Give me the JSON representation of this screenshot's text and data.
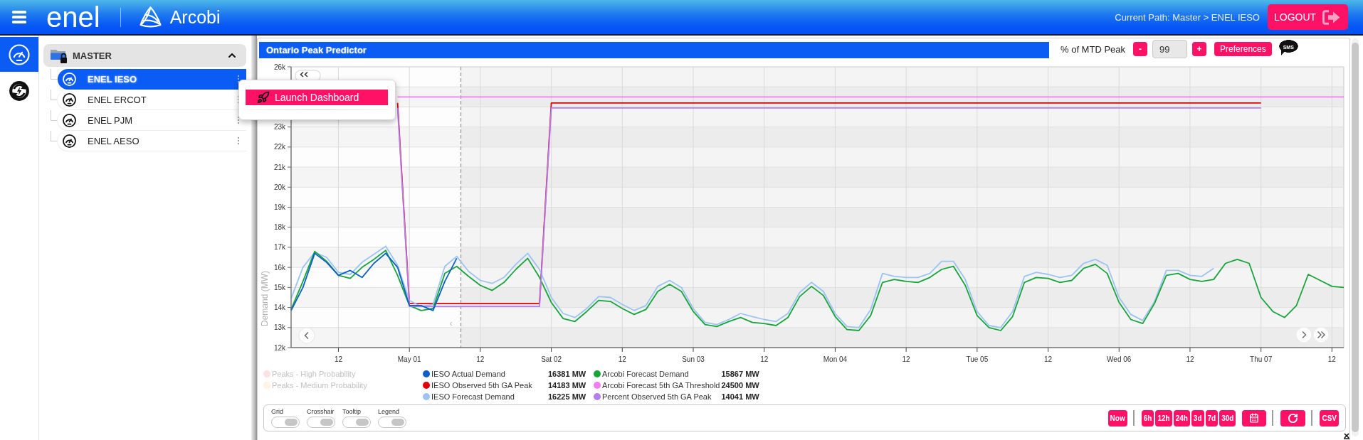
{
  "top_bar": {
    "brand": "enel",
    "app_name": "Arcobi",
    "current_path": "Current Path: Master > ENEL IESO",
    "logout": "LOGOUT"
  },
  "rail": [
    {
      "kind": "gauge",
      "selected": true
    },
    {
      "kind": "lightning",
      "selected": false
    }
  ],
  "tree": {
    "label": "MASTER",
    "expanded": true,
    "children": [
      {
        "label": "ENEL IESO",
        "selected": true
      },
      {
        "label": "ENEL ERCOT",
        "selected": false
      },
      {
        "label": "ENEL PJM",
        "selected": false
      },
      {
        "label": "ENEL AESO",
        "selected": false
      }
    ]
  },
  "context_menu": {
    "items": [
      "Launch Dashboard"
    ]
  },
  "panel": {
    "title": "Ontario Peak Predictor",
    "mtd_label": "% of MTD Peak",
    "decrement": "-",
    "value": "99",
    "increment": "+",
    "preferences": "Preferences",
    "sms": "SMS"
  },
  "chart": {
    "chart_data": {
      "type": "line",
      "ylabel": "Demand (MW)",
      "grid": true,
      "ylim": [
        12000,
        26000
      ],
      "categories": [
        null,
        null,
        null,
        null,
        "12",
        null,
        null,
        null,
        null,
        null,
        "May 01",
        null,
        null,
        null,
        null,
        null,
        "12",
        null,
        null,
        null,
        null,
        null,
        "Sat 02",
        null,
        null,
        null,
        null,
        null,
        "12",
        null,
        null,
        null,
        null,
        null,
        "Sun 03",
        null,
        null,
        null,
        null,
        null,
        "12",
        null,
        null,
        null,
        null,
        null,
        "Mon 04",
        null,
        null,
        null,
        null,
        null,
        "12",
        null,
        null,
        null,
        null,
        null,
        "Tue 05",
        null,
        null,
        null,
        null,
        null,
        "12",
        null,
        null,
        null,
        null,
        null,
        "Wed 06",
        null,
        null,
        null,
        null,
        null,
        "12",
        null,
        null,
        null,
        null,
        null,
        "Thu 07",
        null,
        null,
        null,
        null,
        null,
        "12",
        null
      ],
      "yticks": [
        {
          "value": 12000,
          "label": "12k"
        },
        {
          "value": 13000,
          "label": "13k"
        },
        {
          "value": 14000,
          "label": "14k"
        },
        {
          "value": 15000,
          "label": "15k"
        },
        {
          "value": 16000,
          "label": "16k"
        },
        {
          "value": 17000,
          "label": "17k"
        },
        {
          "value": 18000,
          "label": "18k"
        },
        {
          "value": 19000,
          "label": "19k"
        },
        {
          "value": 20000,
          "label": "20k"
        },
        {
          "value": 21000,
          "label": "21k"
        },
        {
          "value": 22000,
          "label": "22k"
        },
        {
          "value": 23000,
          "label": "23k"
        },
        {
          "value": 26000,
          "label": "26k"
        }
      ],
      "series": [
        {
          "name": "IESO Actual Demand",
          "color": "#0b5fc6",
          "values": [
            13850,
            15000,
            16700,
            16250,
            15600,
            15850,
            15500,
            16200,
            16700,
            16000,
            14100,
            14100,
            13850,
            15300,
            16450,
            null,
            null,
            null,
            null,
            null,
            null,
            null,
            null,
            null,
            null,
            null,
            null,
            null,
            null,
            null,
            null,
            null,
            null,
            null,
            null,
            null,
            null,
            null,
            null,
            null,
            null,
            null,
            null,
            null,
            null,
            null,
            null,
            null,
            null,
            null,
            null,
            null,
            null,
            null,
            null,
            null,
            null,
            null,
            null,
            null,
            null,
            null,
            null,
            null,
            null,
            null,
            null,
            null,
            null,
            null,
            null,
            null,
            null,
            null,
            null,
            null,
            null,
            null,
            null,
            null,
            null,
            null,
            null,
            null,
            null,
            null,
            null,
            null,
            null,
            null
          ]
        },
        {
          "name": "IESO Observed 5th GA Peak",
          "color": "#e00000",
          "values": [
            null,
            null,
            null,
            null,
            null,
            null,
            null,
            null,
            null,
            24200,
            14200,
            14200,
            14200,
            14200,
            14200,
            14200,
            14200,
            14200,
            14200,
            14200,
            14200,
            14200,
            24200,
            24200,
            24200,
            24200,
            24200,
            24200,
            24200,
            24200,
            24200,
            24200,
            24200,
            24200,
            24200,
            24200,
            24200,
            24200,
            24200,
            24200,
            24200,
            24200,
            24200,
            24200,
            24200,
            24200,
            24200,
            24200,
            24200,
            24200,
            24200,
            24200,
            24200,
            24200,
            24200,
            24200,
            24200,
            24200,
            24200,
            24200,
            24200,
            24200,
            24200,
            24200,
            24200,
            24200,
            24200,
            24200,
            24200,
            24200,
            24200,
            24200,
            24200,
            24200,
            24200,
            24200,
            24200,
            24200,
            24200,
            24200,
            24200,
            24200,
            24200,
            null,
            null,
            null,
            null,
            null,
            null,
            null
          ]
        },
        {
          "name": "IESO Forecast Demand",
          "color": "#9cc4f2",
          "values": [
            14450,
            16000,
            16750,
            16500,
            15750,
            15650,
            16250,
            16650,
            17050,
            16100,
            14350,
            14050,
            14150,
            16050,
            16550,
            15800,
            15350,
            15200,
            15500,
            16150,
            16700,
            15900,
            14500,
            13700,
            13500,
            13950,
            14550,
            14500,
            14150,
            13850,
            14100,
            15050,
            15350,
            15000,
            13950,
            13250,
            13150,
            13400,
            13700,
            13550,
            13400,
            13300,
            13700,
            14750,
            15250,
            14800,
            13700,
            13050,
            13000,
            13900,
            15700,
            15550,
            15500,
            15500,
            15700,
            16300,
            16300,
            15400,
            13800,
            13100,
            13000,
            13800,
            15550,
            15750,
            15650,
            15500,
            15600,
            16200,
            16400,
            16100,
            14500,
            13650,
            13350,
            14300,
            15850,
            15850,
            15600,
            15550,
            15950,
            null,
            null,
            null,
            null,
            null,
            null,
            null,
            null,
            null,
            null,
            null
          ]
        },
        {
          "name": "Arcobi Forecast Demand",
          "color": "#17a53a",
          "values": [
            13900,
            15300,
            16800,
            16300,
            15600,
            15450,
            16000,
            16400,
            16850,
            15600,
            14100,
            13850,
            13950,
            15700,
            16050,
            15550,
            15100,
            14850,
            15250,
            15900,
            16450,
            15500,
            14250,
            13450,
            13300,
            13800,
            14350,
            14300,
            13950,
            13650,
            13900,
            14800,
            15150,
            14800,
            13800,
            13150,
            13050,
            13300,
            13500,
            13250,
            13200,
            13100,
            13500,
            14550,
            15050,
            14600,
            13550,
            12900,
            12850,
            13600,
            15250,
            15400,
            15300,
            15250,
            15500,
            15900,
            16050,
            15100,
            13600,
            13000,
            12850,
            13550,
            15250,
            15500,
            15450,
            15250,
            15350,
            15950,
            16150,
            15700,
            14250,
            13400,
            13200,
            14200,
            15600,
            15700,
            15400,
            15300,
            15400,
            16200,
            16400,
            16200,
            14500,
            13800,
            13500,
            14100,
            15650,
            15350,
            15050,
            15000
          ]
        },
        {
          "name": "Arcobi Forecast 5th GA Threshold",
          "color": "#f07ef0",
          "values": [
            null,
            null,
            null,
            null,
            null,
            null,
            null,
            null,
            null,
            24500,
            24500,
            24500,
            24500,
            24500,
            24500,
            24500,
            24500,
            24500,
            24500,
            24500,
            24500,
            24500,
            24500,
            24500,
            24500,
            24500,
            24500,
            24500,
            24500,
            24500,
            24500,
            24500,
            24500,
            24500,
            24500,
            24500,
            24500,
            24500,
            24500,
            24500,
            24500,
            24500,
            24500,
            24500,
            24500,
            24500,
            24500,
            24500,
            24500,
            24500,
            24500,
            24500,
            24500,
            24500,
            24500,
            24500,
            24500,
            24500,
            24500,
            24500,
            24500,
            24500,
            24500,
            24500,
            24500,
            24500,
            24500,
            24500,
            24500,
            24500,
            24500,
            24500,
            24500,
            24500,
            24500,
            24500,
            24500,
            24500,
            24500,
            24500,
            24500,
            24500,
            24500,
            24500,
            24500,
            24500,
            24500,
            24500,
            24500,
            24500
          ]
        },
        {
          "name": "Percent Observed 5th GA Peak",
          "color": "#b27ef0",
          "values": [
            null,
            null,
            null,
            null,
            null,
            null,
            null,
            null,
            null,
            23950,
            14050,
            14050,
            14050,
            14050,
            14050,
            14050,
            14050,
            14050,
            14050,
            14050,
            14050,
            14050,
            23950,
            23950,
            23950,
            23950,
            23950,
            23950,
            23950,
            23950,
            23950,
            23950,
            23950,
            23950,
            23950,
            23950,
            23950,
            23950,
            23950,
            23950,
            23950,
            23950,
            23950,
            23950,
            23950,
            23950,
            23950,
            23950,
            23950,
            23950,
            23950,
            23950,
            23950,
            23950,
            23950,
            23950,
            23950,
            23950,
            23950,
            23950,
            23950,
            23950,
            23950,
            23950,
            23950,
            23950,
            23950,
            23950,
            23950,
            23950,
            23950,
            23950,
            23950,
            23950,
            23950,
            23950,
            23950,
            23950,
            23950,
            23950,
            23950,
            23950,
            23950,
            null,
            null,
            null,
            null,
            null,
            null,
            null
          ]
        }
      ]
    },
    "readings": [
      "16381 MW",
      "14183 MW",
      "16225 MW",
      "15867 MW",
      "24500 MW",
      "14041 MW"
    ],
    "inactive_legend": [
      {
        "label": "Peaks - High Probability",
        "color": "#fbe1e1"
      },
      {
        "label": "Peaks - Medium Probability",
        "color": "#fdf4e2"
      }
    ]
  },
  "controls": {
    "toggles": [
      {
        "label": "Grid",
        "on": true
      },
      {
        "label": "Crosshair",
        "on": true
      },
      {
        "label": "Tooltip",
        "on": true
      },
      {
        "label": "Legend",
        "on": true
      }
    ],
    "now": "Now",
    "ranges": [
      "6h",
      "12h",
      "24h",
      "3d",
      "7d",
      "30d"
    ],
    "csv": "CSV"
  }
}
